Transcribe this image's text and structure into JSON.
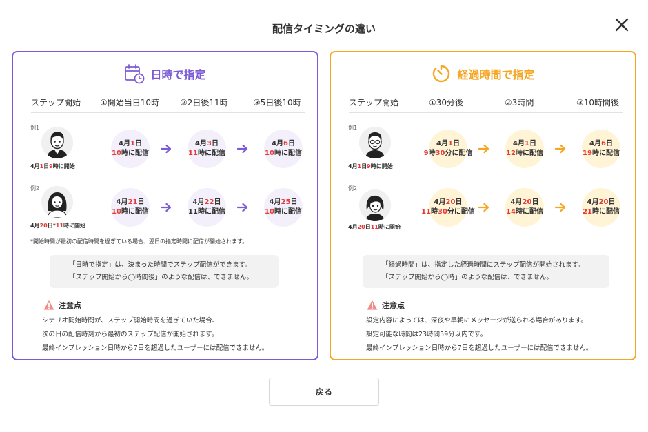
{
  "modal": {
    "title": "配信タイミングの違い"
  },
  "colors": {
    "datetime_accent": "#7b5cd6",
    "elapsed_accent": "#f5a623",
    "highlight": "#e53935"
  },
  "left": {
    "title": "日時で指定",
    "icon": "calendar-clock-icon",
    "steps": [
      "ステップ開始",
      "①開始当日10時",
      "②2日後11時",
      "③5日後10時"
    ],
    "examples": [
      {
        "label": "例1",
        "start": [
          [
            "4月",
            ""
          ],
          [
            "1",
            "hl"
          ],
          [
            "日",
            ""
          ],
          [
            "9",
            "hl"
          ],
          [
            "時に開始",
            ""
          ]
        ],
        "bubbles": [
          [
            [
              [
                "4月",
                ""
              ],
              [
                "1",
                "hl"
              ],
              [
                "日",
                ""
              ]
            ],
            [
              [
                "10",
                "hl"
              ],
              [
                "時に配信",
                ""
              ]
            ]
          ],
          [
            [
              [
                "4月",
                ""
              ],
              [
                "3",
                "hl"
              ],
              [
                "日",
                ""
              ]
            ],
            [
              [
                "11",
                "hl"
              ],
              [
                "時に配信",
                ""
              ]
            ]
          ],
          [
            [
              [
                "4月",
                ""
              ],
              [
                "6",
                "hl"
              ],
              [
                "日",
                ""
              ]
            ],
            [
              [
                "10",
                "hl"
              ],
              [
                "時に配信",
                ""
              ]
            ]
          ]
        ]
      },
      {
        "label": "例2",
        "start": [
          [
            "4月",
            ""
          ],
          [
            "20",
            "hl"
          ],
          [
            "日*",
            ""
          ],
          [
            "11",
            "hl"
          ],
          [
            "時に開始",
            ""
          ]
        ],
        "bubbles": [
          [
            [
              [
                "4月",
                ""
              ],
              [
                "21",
                "hl"
              ],
              [
                "日",
                ""
              ]
            ],
            [
              [
                "10",
                "hl"
              ],
              [
                "時に配信",
                ""
              ]
            ]
          ],
          [
            [
              [
                "4月",
                ""
              ],
              [
                "22",
                "hl"
              ],
              [
                "日",
                ""
              ]
            ],
            [
              [
                "11",
                ""
              ],
              [
                "時に配信",
                ""
              ]
            ]
          ],
          [
            [
              [
                "4月",
                ""
              ],
              [
                "25",
                "hl"
              ],
              [
                "日",
                ""
              ]
            ],
            [
              [
                "10",
                "hl"
              ],
              [
                "時に配信",
                ""
              ]
            ]
          ]
        ]
      }
    ],
    "footnote": "*開始時間が最初の配信時間を過ぎている場合、翌日の指定時間に配信が開始されます。",
    "info": [
      "「日時で指定」は、決まった時間でステップ配信ができます。",
      "「ステップ開始から◯時間後」のような配信は、できません。"
    ],
    "caution_title": "注意点",
    "caution": [
      "シナリオ開始時間が、ステップ開始時間を過ぎていた場合、",
      "次の日の配信時刻から最初のステップ配信が開始されます。",
      "最終インプレッション日時から7日を超過したユーザーには配信できません。"
    ]
  },
  "right": {
    "title": "経過時間で指定",
    "icon": "timer-icon",
    "steps": [
      "ステップ開始",
      "①30分後",
      "②3時間",
      "③10時間後"
    ],
    "examples": [
      {
        "label": "例1",
        "start": [
          [
            "4月",
            ""
          ],
          [
            "1",
            "hl"
          ],
          [
            "日",
            ""
          ],
          [
            "9",
            "hl"
          ],
          [
            "時に開始",
            ""
          ]
        ],
        "bubbles": [
          [
            [
              [
                "4月",
                ""
              ],
              [
                "1",
                "hl"
              ],
              [
                "日",
                ""
              ]
            ],
            [
              [
                "9",
                "hl"
              ],
              [
                "時",
                ""
              ],
              [
                "30",
                "hl"
              ],
              [
                "分に配信",
                ""
              ]
            ]
          ],
          [
            [
              [
                "4月",
                ""
              ],
              [
                "1",
                "hl"
              ],
              [
                "日",
                ""
              ]
            ],
            [
              [
                "12",
                "hl"
              ],
              [
                "時に配信",
                ""
              ]
            ]
          ],
          [
            [
              [
                "4月",
                ""
              ],
              [
                "6",
                "hl"
              ],
              [
                "日",
                ""
              ]
            ],
            [
              [
                "19",
                "hl"
              ],
              [
                "時に配信",
                ""
              ]
            ]
          ]
        ]
      },
      {
        "label": "例2",
        "start": [
          [
            "4月",
            ""
          ],
          [
            "20",
            "hl"
          ],
          [
            "日",
            ""
          ],
          [
            "11",
            "hl"
          ],
          [
            "時に開始",
            ""
          ]
        ],
        "bubbles": [
          [
            [
              [
                "4月",
                ""
              ],
              [
                "20",
                "hl"
              ],
              [
                "日",
                ""
              ]
            ],
            [
              [
                "11",
                "hl"
              ],
              [
                "時",
                ""
              ],
              [
                "30",
                "hl"
              ],
              [
                "分に配信",
                ""
              ]
            ]
          ],
          [
            [
              [
                "4月",
                ""
              ],
              [
                "20",
                "hl"
              ],
              [
                "日",
                ""
              ]
            ],
            [
              [
                "14",
                "hl"
              ],
              [
                "時に配信",
                ""
              ]
            ]
          ],
          [
            [
              [
                "4月",
                ""
              ],
              [
                "20",
                "hl"
              ],
              [
                "日",
                ""
              ]
            ],
            [
              [
                "21",
                "hl"
              ],
              [
                "時に配信",
                ""
              ]
            ]
          ]
        ]
      }
    ],
    "info": [
      "「経過時間」は、指定した経過時間にステップ配信が開始されます。",
      "「ステップ開始から◯時」のような配信は、できません。"
    ],
    "caution_title": "注意点",
    "caution": [
      "設定内容によっては、深夜や早朝にメッセージが送られる場合があります。",
      "設定可能な時間は23時間59分以内です。",
      "最終インプレッション日時から7日を超過したユーザーには配信できません。"
    ]
  },
  "footer": {
    "back_label": "戻る"
  }
}
